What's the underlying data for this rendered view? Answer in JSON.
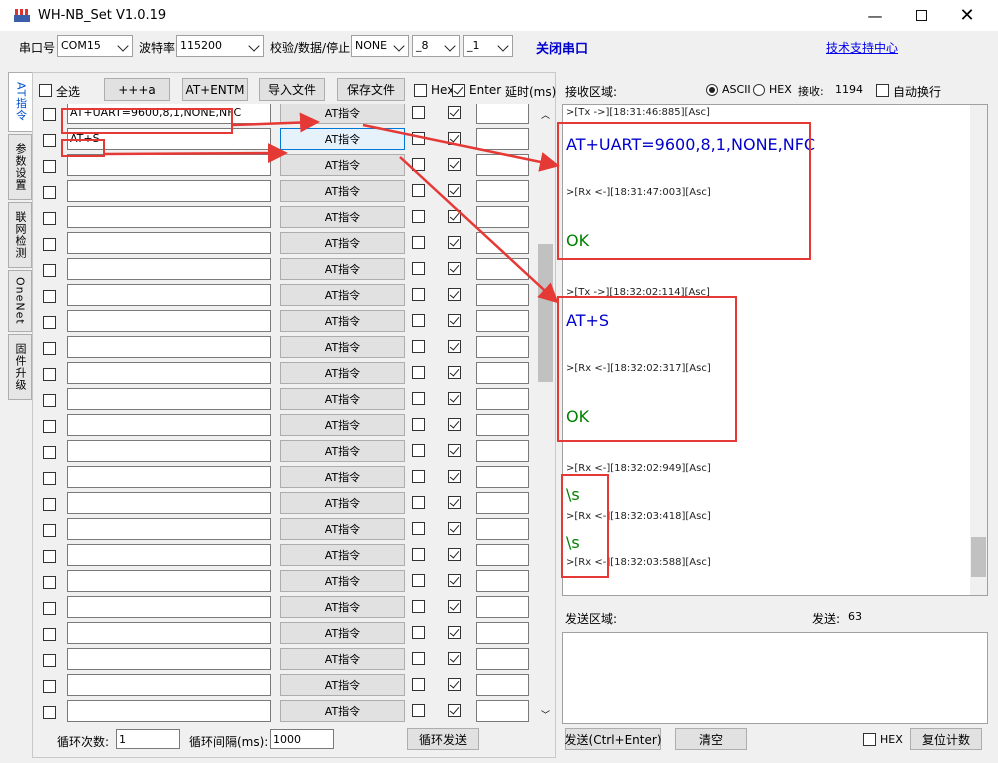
{
  "window": {
    "title": "WH-NB_Set V1.0.19"
  },
  "toolbar": {
    "port_label": "串口号",
    "port_value": "COM15",
    "baud_label": "波特率",
    "baud_value": "115200",
    "parity_label": "校验/数据/停止",
    "parity_value": "NONE",
    "data_bits": "_8",
    "stop_bits": "_1",
    "close_port": "关闭串口",
    "support_link": "技术支持中心"
  },
  "tabs": [
    "AT指令",
    "参数设置",
    "联网检测",
    "OneNet",
    "固件升级"
  ],
  "left": {
    "select_all": "全选",
    "btn_plus": "+++a",
    "btn_entm": "AT+ENTM",
    "btn_import": "导入文件",
    "btn_save": "保存文件",
    "col_hex": "Hex",
    "col_enter": "Enter",
    "col_delay": "延时(ms)",
    "commands": [
      "AT+UART=9600,8,1,NONE,NFC",
      "AT+S",
      "",
      "",
      "",
      "",
      "",
      "",
      "",
      "",
      "",
      "",
      "",
      "",
      "",
      "",
      "",
      "",
      "",
      "",
      "",
      "",
      "",
      "",
      ""
    ],
    "row_button": "AT指令",
    "loop_count_label": "循环次数:",
    "loop_count": "1",
    "loop_interval_label": "循环间隔(ms):",
    "loop_interval": "1000",
    "loop_send": "循环发送"
  },
  "right": {
    "recv_label": "接收区域:",
    "ascii": "ASCII",
    "hex": "HEX",
    "recv_count_label": "接收:",
    "recv_count": "1194",
    "auto_wrap": "自动换行",
    "log": [
      {
        "cls": "hdr",
        "text": ">[Tx ->][18:31:46:885][Asc]"
      },
      {
        "cls": "tx",
        "text": "AT+UART=9600,8,1,NONE,NFC"
      },
      {
        "cls": "hdr",
        "text": ">[Rx <-][18:31:47:003][Asc]"
      },
      {
        "cls": "ok",
        "text": "OK"
      },
      {
        "cls": "hdr",
        "text": ">[Tx ->][18:32:02:114][Asc]"
      },
      {
        "cls": "tx",
        "text": "AT+S"
      },
      {
        "cls": "hdr",
        "text": ">[Rx <-][18:32:02:317][Asc]"
      },
      {
        "cls": "ok",
        "text": "OK"
      },
      {
        "cls": "hdr",
        "text": ">[Rx <-][18:32:02:949][Asc]"
      },
      {
        "cls": "ok",
        "text": "\\s"
      },
      {
        "cls": "hdr",
        "text": ">[Rx <-][18:32:03:418][Asc]"
      },
      {
        "cls": "ok",
        "text": "\\s"
      },
      {
        "cls": "hdr",
        "text": ">[Rx <-][18:32:03:588][Asc]"
      }
    ],
    "send_label": "发送区域:",
    "send_count_label": "发送:",
    "send_count": "63",
    "send_btn": "发送(Ctrl+Enter)",
    "clear_btn": "清空",
    "hex_label": "HEX",
    "reset_btn": "复位计数"
  },
  "colors": {
    "annotation": "#e53935",
    "tx_text": "#0000cc",
    "ok_text": "#008000"
  }
}
